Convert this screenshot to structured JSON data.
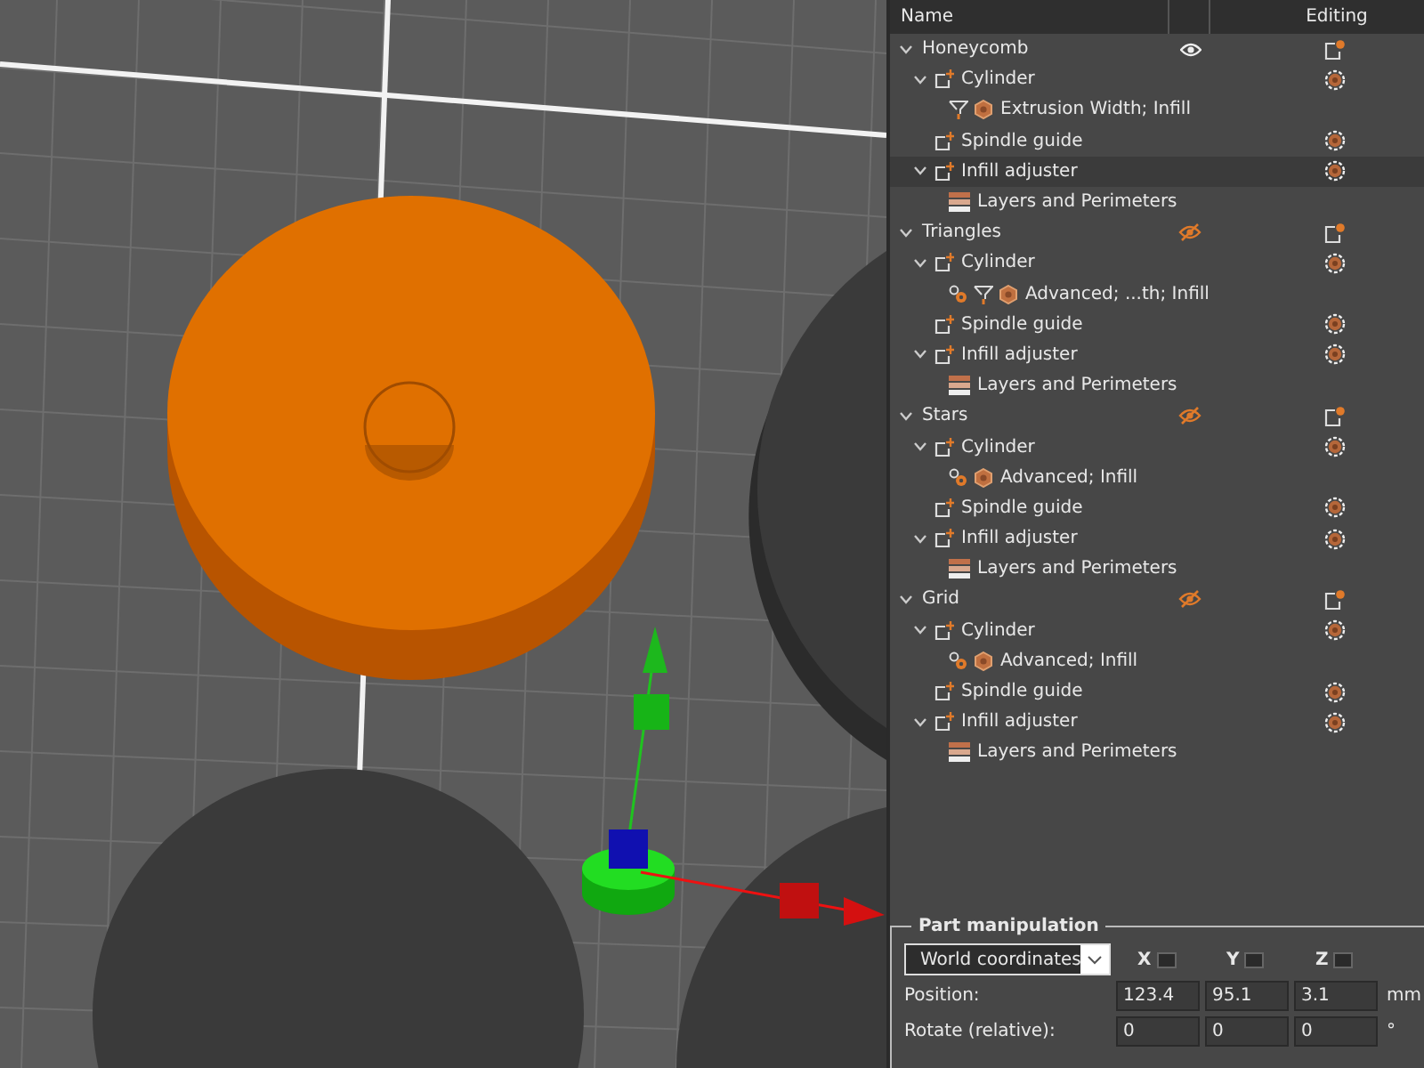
{
  "tree": {
    "header": {
      "name": "Name",
      "editing": "Editing"
    },
    "objects": [
      {
        "name": "Honeycomb",
        "expanded": true,
        "visible": true,
        "selected": false,
        "children": [
          {
            "kind": "part",
            "name": "Cylinder",
            "expanded": true,
            "selected": false,
            "children": [
              {
                "kind": "settings",
                "name": "Extrusion Width; Infill",
                "icons": [
                  {
                    "kind": "funnel"
                  },
                  {
                    "kind": "infill"
                  }
                ],
                "selected": false
              }
            ]
          },
          {
            "kind": "part",
            "name": "Spindle guide",
            "selected": false
          },
          {
            "kind": "part",
            "name": "Infill adjuster",
            "expanded": true,
            "selected": true,
            "children": [
              {
                "kind": "layers",
                "name": "Layers and Perimeters",
                "selected": false
              }
            ]
          }
        ]
      },
      {
        "name": "Triangles",
        "expanded": true,
        "visible": false,
        "selected": false,
        "children": [
          {
            "kind": "part",
            "name": "Cylinder",
            "expanded": true,
            "selected": false,
            "children": [
              {
                "kind": "settings",
                "name": "Advanced; ...th; Infill",
                "icons": [
                  {
                    "kind": "gears"
                  },
                  {
                    "kind": "funnel"
                  },
                  {
                    "kind": "infill"
                  }
                ],
                "selected": false
              }
            ]
          },
          {
            "kind": "part",
            "name": "Spindle guide",
            "selected": false
          },
          {
            "kind": "part",
            "name": "Infill adjuster",
            "expanded": true,
            "selected": false,
            "children": [
              {
                "kind": "layers",
                "name": "Layers and Perimeters",
                "selected": false
              }
            ]
          }
        ]
      },
      {
        "name": "Stars",
        "expanded": true,
        "visible": false,
        "selected": false,
        "children": [
          {
            "kind": "part",
            "name": "Cylinder",
            "expanded": true,
            "selected": false,
            "children": [
              {
                "kind": "settings",
                "name": "Advanced; Infill",
                "icons": [
                  {
                    "kind": "gears"
                  },
                  {
                    "kind": "infill"
                  }
                ],
                "selected": false
              }
            ]
          },
          {
            "kind": "part",
            "name": "Spindle guide",
            "selected": false
          },
          {
            "kind": "part",
            "name": "Infill adjuster",
            "expanded": true,
            "selected": false,
            "children": [
              {
                "kind": "layers",
                "name": "Layers and Perimeters",
                "selected": false
              }
            ]
          }
        ]
      },
      {
        "name": "Grid",
        "expanded": true,
        "visible": false,
        "selected": false,
        "children": [
          {
            "kind": "part",
            "name": "Cylinder",
            "expanded": true,
            "selected": false,
            "children": [
              {
                "kind": "settings",
                "name": "Advanced; Infill",
                "icons": [
                  {
                    "kind": "gears"
                  },
                  {
                    "kind": "infill"
                  }
                ],
                "selected": false
              }
            ]
          },
          {
            "kind": "part",
            "name": "Spindle guide",
            "selected": false
          },
          {
            "kind": "part",
            "name": "Infill adjuster",
            "expanded": true,
            "selected": false,
            "children": [
              {
                "kind": "layers",
                "name": "Layers and Perimeters",
                "selected": false
              }
            ]
          }
        ]
      }
    ]
  },
  "manipulation": {
    "title": "Part manipulation",
    "coordinates": "World coordinates",
    "axes": [
      "X",
      "Y",
      "Z"
    ],
    "rows": [
      {
        "label": "Position:",
        "values": [
          "123.4",
          "95.1",
          "3.1"
        ],
        "unit": "mm"
      },
      {
        "label": "Rotate (relative):",
        "values": [
          "0",
          "0",
          "0"
        ],
        "unit": "°"
      }
    ]
  }
}
